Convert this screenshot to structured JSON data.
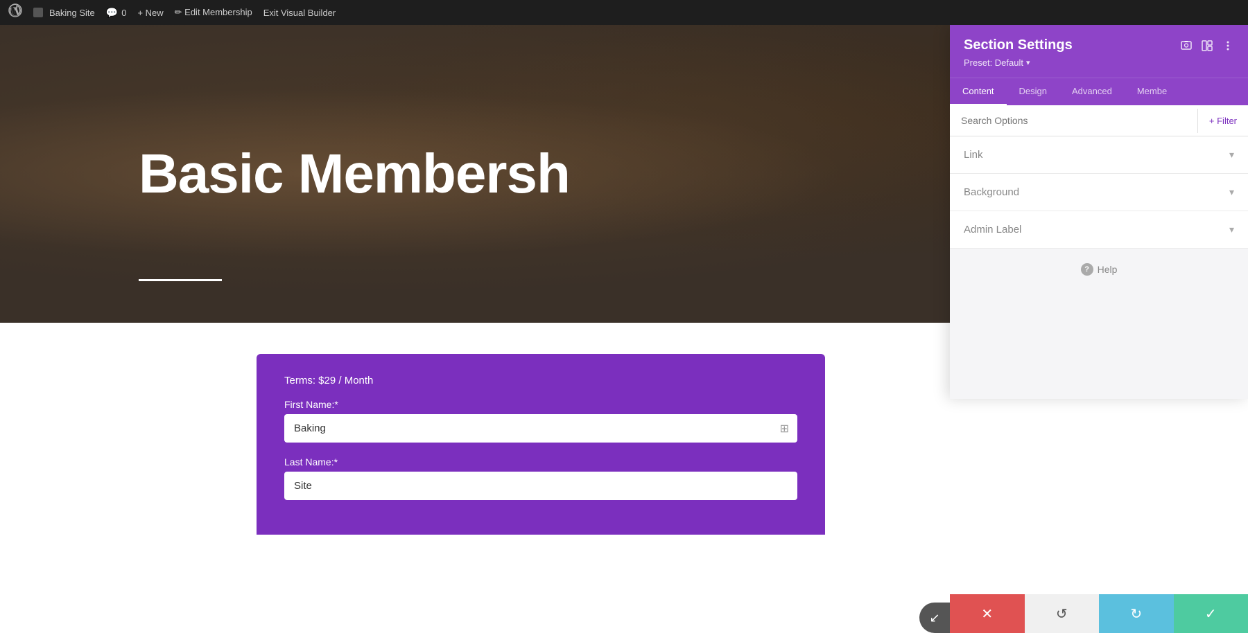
{
  "admin_bar": {
    "wp_icon": "⊕",
    "site_name": "Baking Site",
    "comments_icon": "💬",
    "comments_count": "0",
    "new_label": "+ New",
    "edit_label": "✏ Edit Membership",
    "exit_label": "Exit Visual Builder"
  },
  "hero": {
    "text": "Basic Membersh",
    "overlay_text": "Basic Membership"
  },
  "form": {
    "terms": "Terms: $29 / Month",
    "first_name_label": "First Name:*",
    "first_name_value": "Baking",
    "last_name_label": "Last Name:*",
    "last_name_value": "Site"
  },
  "panel": {
    "title": "Section Settings",
    "preset": "Preset: Default",
    "tabs": [
      {
        "label": "Content",
        "active": true
      },
      {
        "label": "Design",
        "active": false
      },
      {
        "label": "Advanced",
        "active": false
      },
      {
        "label": "Membe",
        "active": false
      }
    ],
    "search_placeholder": "Search Options",
    "filter_label": "+ Filter",
    "accordions": [
      {
        "label": "Link",
        "open": false
      },
      {
        "label": "Background",
        "open": false
      },
      {
        "label": "Admin Label",
        "open": false
      }
    ],
    "help_label": "Help"
  },
  "action_bar": {
    "cancel_icon": "✕",
    "undo_icon": "↺",
    "redo_icon": "↻",
    "save_icon": "✓"
  },
  "float_btn": {
    "icon": "↙"
  }
}
